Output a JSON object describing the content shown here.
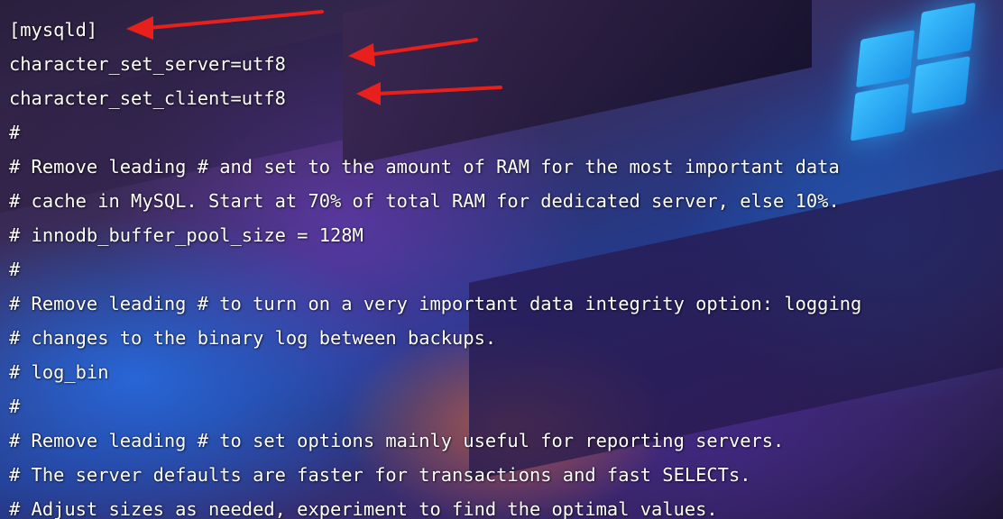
{
  "terminal": {
    "lines": [
      "[mysqld]",
      "character_set_server=utf8",
      "character_set_client=utf8",
      "#",
      "# Remove leading # and set to the amount of RAM for the most important data",
      "# cache in MySQL. Start at 70% of total RAM for dedicated server, else 10%.",
      "# innodb_buffer_pool_size = 128M",
      "#",
      "# Remove leading # to turn on a very important data integrity option: logging",
      "# changes to the binary log between backups.",
      "# log_bin",
      "#",
      "# Remove leading # to set options mainly useful for reporting servers.",
      "# The server defaults are faster for transactions and fast SELECTs.",
      "# Adjust sizes as needed, experiment to find the optimal values."
    ]
  },
  "annotations": {
    "arrow_color": "#e8201c",
    "arrows_point_to": [
      "[mysqld]",
      "character_set_server=utf8",
      "character_set_client=utf8"
    ]
  },
  "wallpaper": {
    "logo_icon": "windows-logo-icon",
    "accent_color": "#2fb4ff"
  }
}
